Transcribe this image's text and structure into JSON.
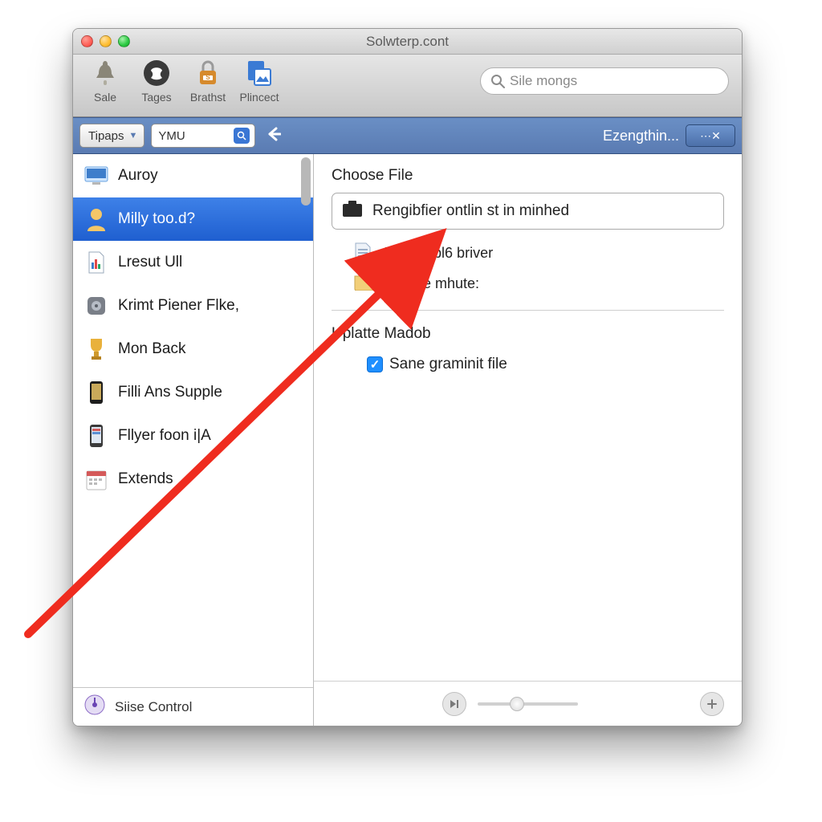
{
  "window": {
    "title": "Solwterp.cont"
  },
  "toolbar": {
    "items": [
      {
        "label": "Sale",
        "icon": "bell-icon"
      },
      {
        "label": "Tages",
        "icon": "person-icon"
      },
      {
        "label": "Brathst",
        "icon": "lock-icon"
      },
      {
        "label": "Plincect",
        "icon": "image-icon"
      }
    ],
    "search": {
      "placeholder": "Sile mongs"
    }
  },
  "bluebar": {
    "dropdown": "Tipaps",
    "mini_search": "YMU",
    "breadcrumb": "Ezengthin...",
    "tool_label": "⋯✕"
  },
  "sidebar": {
    "items": [
      {
        "label": "Auroy",
        "icon": "monitor-icon"
      },
      {
        "label": "Milly too.d?",
        "icon": "user-icon"
      },
      {
        "label": "Lresut Ull",
        "icon": "doc-icon"
      },
      {
        "label": "Krimt Piener Flke,",
        "icon": "drive-icon"
      },
      {
        "label": "Mon Back",
        "icon": "trophy-icon"
      },
      {
        "label": "Filli Ans Supple",
        "icon": "phone-icon"
      },
      {
        "label": "Fllyer foon i|A",
        "icon": "phone2-icon"
      },
      {
        "label": "Extends",
        "icon": "calendar-icon"
      }
    ],
    "selected_index": 1,
    "footer": {
      "label": "Siise Control",
      "icon": "dial-icon"
    }
  },
  "detail": {
    "choose_label": "Choose File",
    "file_field": "Rengibfier ontlin st in minhed",
    "rows": [
      {
        "label": "AdwlA abl6 briver",
        "icon": "page-icon"
      },
      {
        "label": "Cample mhute:",
        "icon": "folder-icon"
      }
    ],
    "update_label": "Uplatte Madob",
    "checkbox_label": "Sane graminit file",
    "checkbox_checked": true
  },
  "colors": {
    "selection": "#2d6be0",
    "bluebar": "#5c81b8",
    "arrow": "#ef2c1f"
  }
}
